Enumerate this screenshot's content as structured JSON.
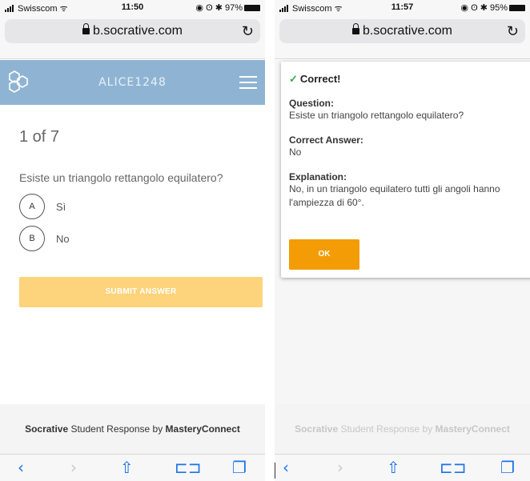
{
  "left": {
    "status": {
      "carrier": "Swisscom",
      "time": "11:50",
      "battery": "97%"
    },
    "url": "b.socrative.com",
    "room_name": "ALICE1248",
    "progress": "1 of 7",
    "question": "Esiste un triangolo rettangolo equilatero?",
    "choices": [
      {
        "letter": "A",
        "label": "Sì"
      },
      {
        "letter": "B",
        "label": "No"
      }
    ],
    "submit_label": "SUBMIT ANSWER",
    "footer": {
      "brand": "Socrative",
      "middle": " Student Response by ",
      "company": "MasteryConnect"
    }
  },
  "right": {
    "status": {
      "carrier": "Swisscom",
      "time": "11:57",
      "battery": "95%"
    },
    "url": "b.socrative.com",
    "result_title": "Correct!",
    "question_label": "Question:",
    "question_text": "Esiste un triangolo rettangolo equilatero?",
    "answer_label": "Correct Answer:",
    "answer_text": "No",
    "explanation_label": "Explanation:",
    "explanation_text": "No, in un triangolo equilatero tutti gli angoli hanno l'ampiezza di 60°.",
    "ok_label": "OK",
    "footer": {
      "brand": "Socrative",
      "middle": " Student Response by ",
      "company": "MasteryConnect"
    }
  },
  "colors": {
    "header": "#8fb4d3",
    "submit": "#fdd37b",
    "ok": "#f49c06",
    "safari_blue": "#1a73e8",
    "check": "#3aa84a"
  },
  "icons": [
    "signal-icon",
    "wifi-icon",
    "lock-icon",
    "reload-icon",
    "logo-icon",
    "menu-icon",
    "back-icon",
    "forward-icon",
    "share-icon",
    "bookmarks-icon",
    "tabs-icon",
    "check-icon"
  ]
}
